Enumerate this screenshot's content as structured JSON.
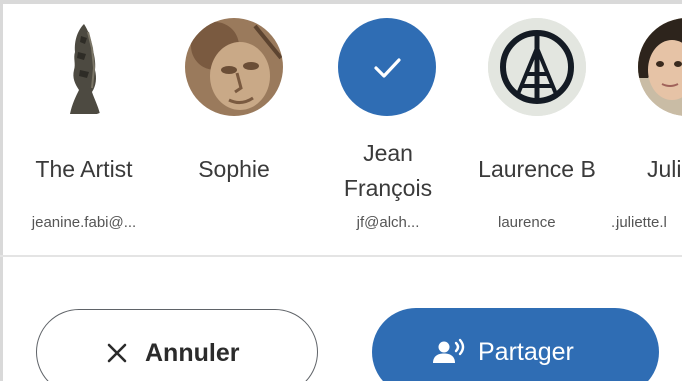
{
  "contacts": [
    {
      "name": "The Artist",
      "email": "jeanine.fabi@...",
      "avatar_icon": "bronze-sculpture-photo"
    },
    {
      "name": "Sophie",
      "email": "",
      "avatar_icon": "stone-relief-face-photo"
    },
    {
      "name_line1": "Jean",
      "name_line2": "François",
      "email": "jf@alch...",
      "avatar_icon": "check-icon",
      "selected": true
    },
    {
      "name": "Laurence B",
      "email": "laurence",
      "email_ellipsis": "...",
      "avatar_icon": "peace-eiffel-symbol"
    },
    {
      "name": "Juli",
      "email": "juliette.l",
      "avatar_icon": "person-photo"
    }
  ],
  "actions": {
    "cancel_label": "Annuler",
    "share_label": "Partager"
  },
  "colors": {
    "accent": "#2f6db4",
    "text": "#3a3a3a",
    "divider": "#e4e4e4"
  }
}
